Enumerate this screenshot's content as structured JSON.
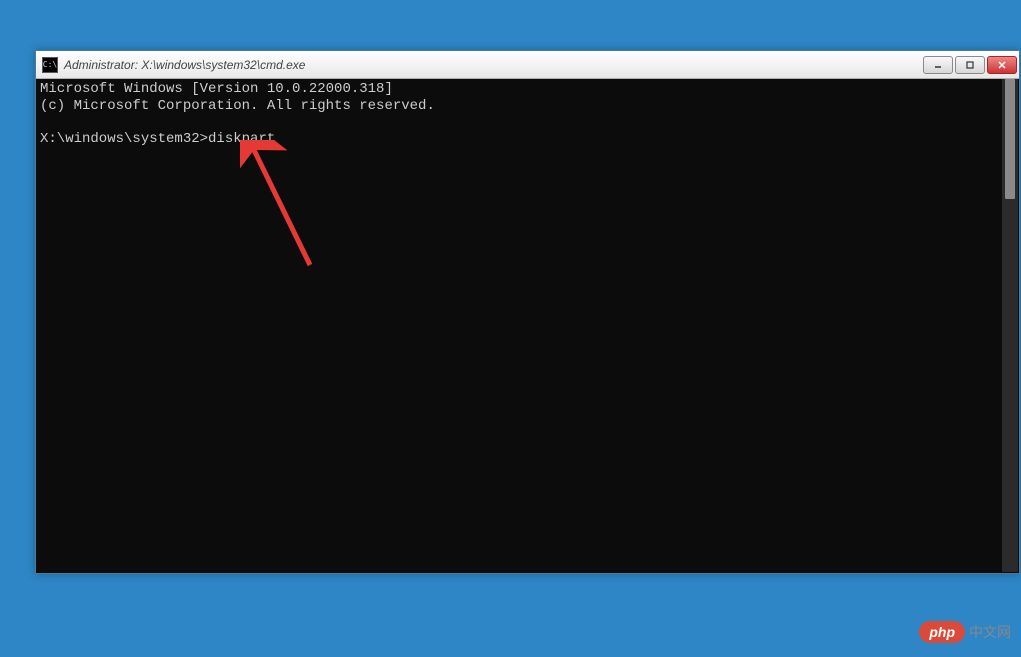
{
  "window": {
    "title": "Administrator: X:\\windows\\system32\\cmd.exe",
    "icon_label": "C:\\"
  },
  "terminal": {
    "line1": "Microsoft Windows [Version 10.0.22000.318]",
    "line2": "(c) Microsoft Corporation. All rights reserved.",
    "blank": "",
    "prompt": "X:\\windows\\system32>",
    "command": "diskpart"
  },
  "watermark": {
    "pill": "php",
    "text": "中文网"
  }
}
